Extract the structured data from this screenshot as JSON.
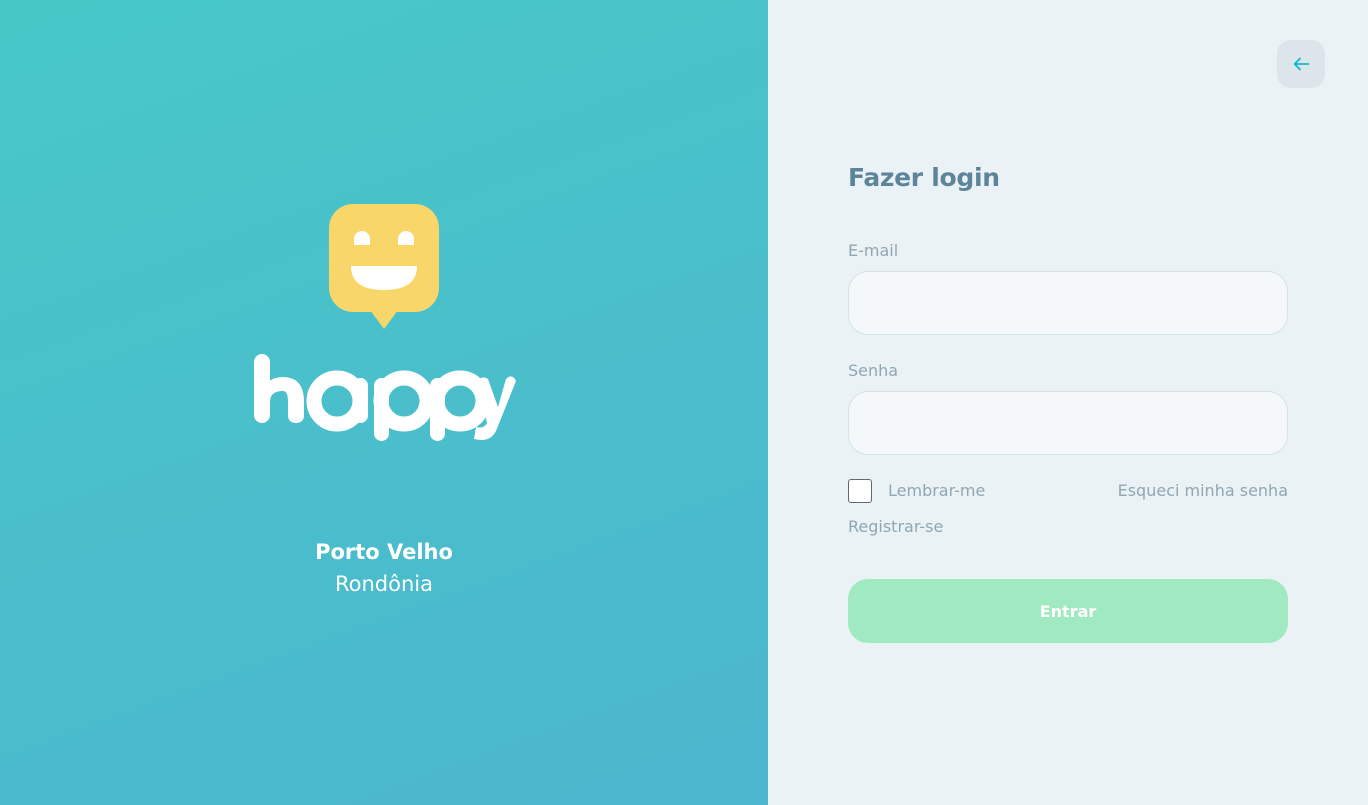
{
  "brand": {
    "logo_text": "happy",
    "logo_icon": "smiley-speech-bubble-icon",
    "city": "Porto Velho",
    "state": "Rondônia",
    "colors": {
      "gradient_start": "#47c8c7",
      "gradient_end": "#4cb6cf",
      "logo_yellow": "#f9d66a"
    }
  },
  "login": {
    "back_icon": "arrow-left-icon",
    "title": "Fazer login",
    "email_label": "E-mail",
    "email_value": "",
    "password_label": "Senha",
    "password_value": "",
    "remember_label": "Lembrar-me",
    "remember_checked": false,
    "forgot_password": "Esqueci minha senha",
    "register": "Registrar-se",
    "submit_label": "Entrar",
    "colors": {
      "panel_bg": "#ebf2f5",
      "title": "#5c8599",
      "muted_text": "#8fa7b3",
      "button_green": "#a1e9c1",
      "back_arrow": "#15b6d6"
    }
  }
}
